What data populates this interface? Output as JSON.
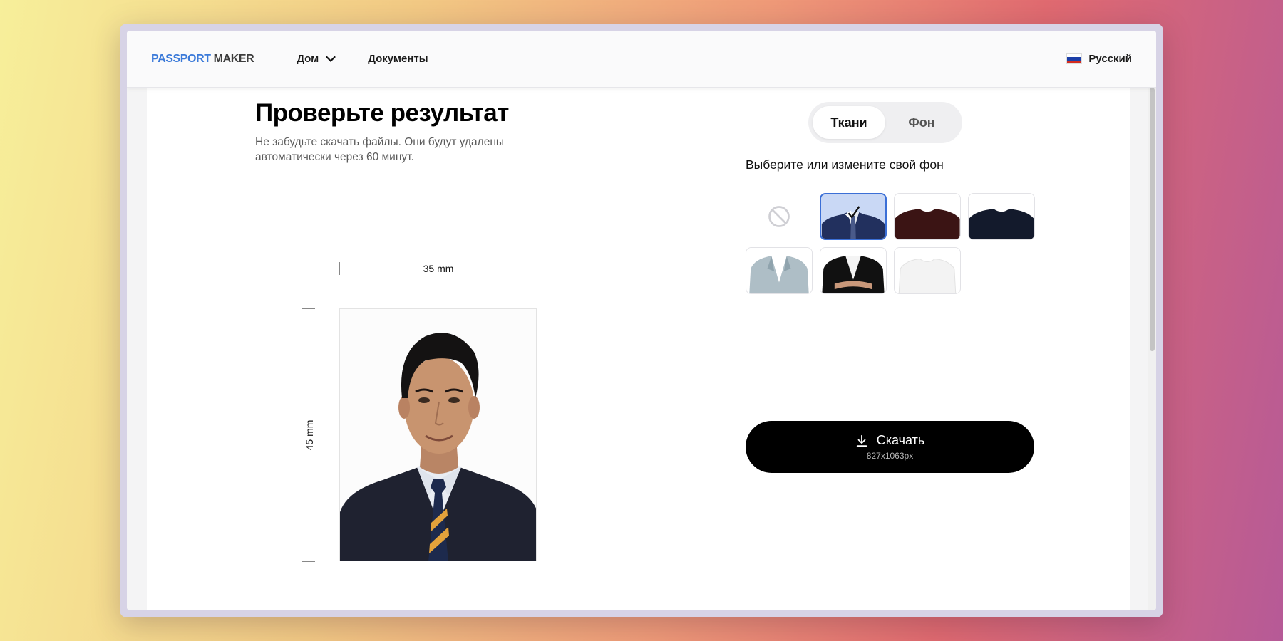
{
  "header": {
    "logo_part1": "PASSPORT",
    "logo_part2": "MAKER",
    "nav": [
      {
        "label": "Дом"
      },
      {
        "label": "Документы"
      }
    ],
    "language": "Русский"
  },
  "left": {
    "title": "Проверьте результат",
    "subtitle": "Не забудьте скачать файлы. Они будут удалены автоматически через 60 минут.",
    "width_label": "35 mm",
    "height_label": "45 mm"
  },
  "right": {
    "tabs": [
      {
        "label": "Ткани",
        "active": true
      },
      {
        "label": "Фон",
        "active": false
      }
    ],
    "choose_text": "Выберите или измените свой фон",
    "outfits": [
      {
        "name": "none",
        "selected": false
      },
      {
        "name": "navy-suit-tie",
        "selected": true
      },
      {
        "name": "burgundy-sweater",
        "selected": false
      },
      {
        "name": "navy-sweater",
        "selected": false
      },
      {
        "name": "tweed-blazer",
        "selected": false
      },
      {
        "name": "black-blazer-white-shirt",
        "selected": false
      },
      {
        "name": "white-tshirt",
        "selected": false
      }
    ],
    "download_label": "Скачать",
    "download_size": "827x1063px"
  },
  "colors": {
    "accent": "#3b7ad9",
    "selected_border": "#3b6fd6"
  }
}
